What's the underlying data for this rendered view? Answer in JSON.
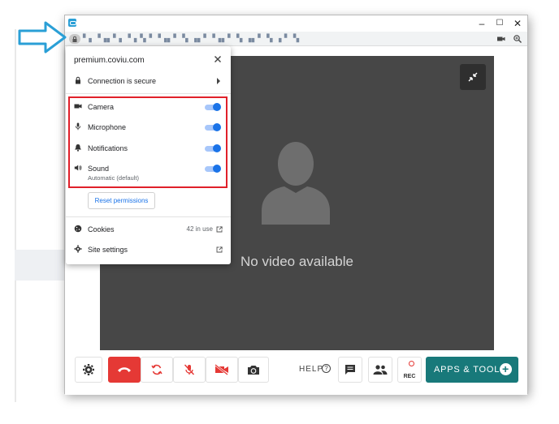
{
  "popup": {
    "host": "premium.coviu.com",
    "connection_label": "Connection is secure",
    "permissions": [
      {
        "label": "Camera",
        "icon": "camera-icon",
        "enabled": true
      },
      {
        "label": "Microphone",
        "icon": "microphone-icon",
        "enabled": true
      },
      {
        "label": "Notifications",
        "icon": "bell-icon",
        "enabled": true
      },
      {
        "label": "Sound",
        "sub": "Automatic (default)",
        "icon": "speaker-icon",
        "enabled": true
      }
    ],
    "reset_label": "Reset permissions",
    "cookies_label": "Cookies",
    "cookies_count": "42 in use",
    "site_settings_label": "Site settings"
  },
  "video": {
    "no_video_text": "No video available"
  },
  "toolbar": {
    "help_label": "HELP",
    "help_icon": "?",
    "rec_label": "REC",
    "apps_label": "APPS & TOOLS",
    "apps_plus": "+"
  },
  "window": {
    "minimize": "–",
    "maximize": "☐",
    "close": "✕"
  },
  "colors": {
    "accent": "#1a73e8",
    "highlight": "#e0202a",
    "hangup": "#e53935",
    "apps": "#18797a",
    "video_bg": "#474747",
    "arrow": "#2a9fd6"
  }
}
